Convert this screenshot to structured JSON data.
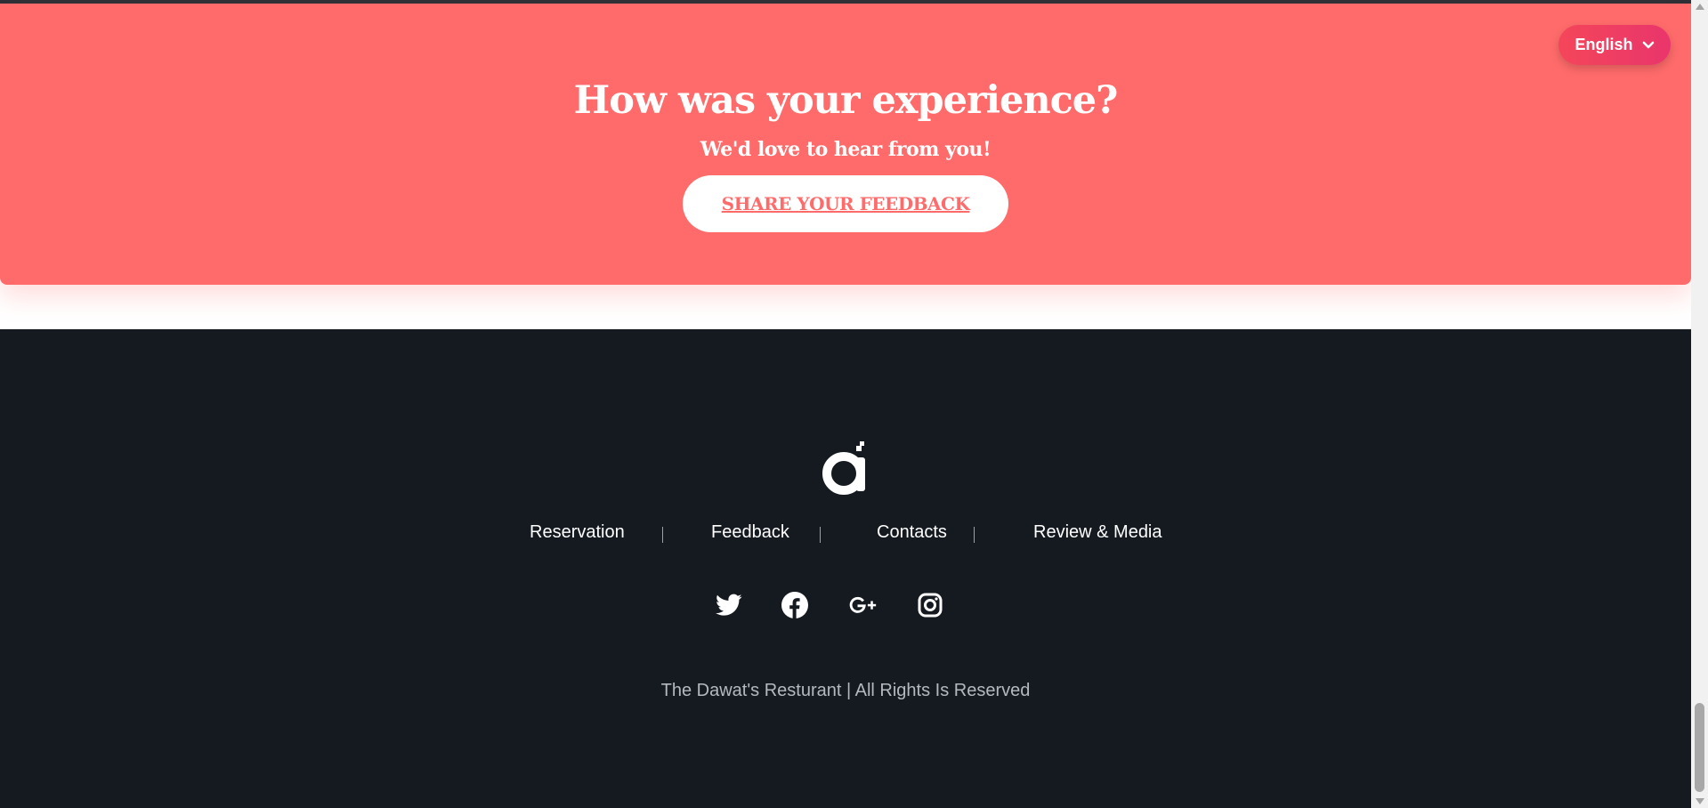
{
  "banner": {
    "title": "How was your experience?",
    "subtitle": "We'd love to hear from you!",
    "button_label": "SHARE YOUR FEEDBACK",
    "background_color": "#ff6b6b"
  },
  "language": {
    "selected": "English",
    "icon": "chevron-down-icon"
  },
  "footer": {
    "logo_icon": "brand-logo-icon",
    "nav": [
      {
        "label": "Reservation"
      },
      {
        "label": "Feedback"
      },
      {
        "label": "Contacts"
      },
      {
        "label": "Review & Media"
      }
    ],
    "social": [
      {
        "icon": "twitter-icon"
      },
      {
        "icon": "facebook-icon"
      },
      {
        "icon": "google-plus-icon"
      },
      {
        "icon": "instagram-icon"
      }
    ],
    "copyright": "The Dawat's Resturant | All Rights Is Reserved",
    "background_color": "#151a21"
  }
}
